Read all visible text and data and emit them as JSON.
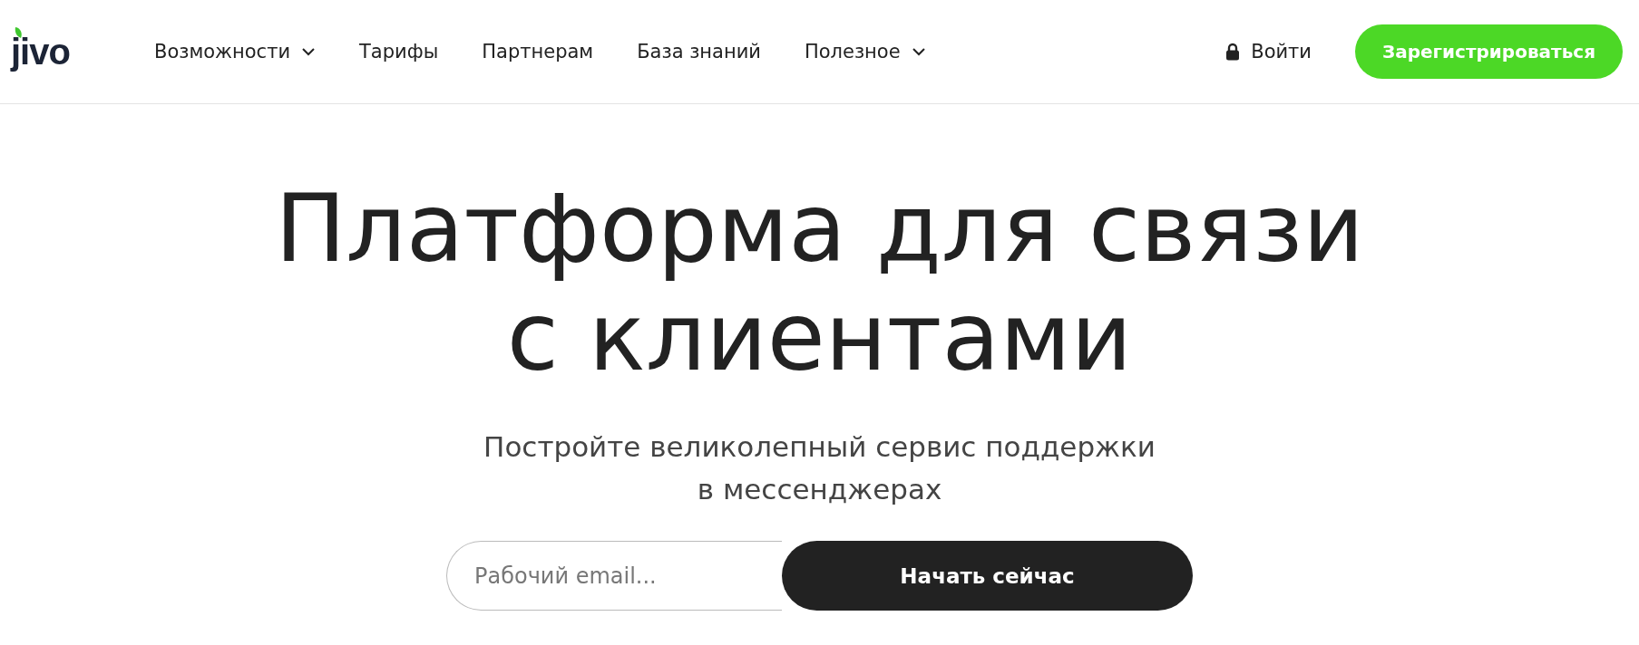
{
  "logo": {
    "text": "jivo"
  },
  "nav": [
    {
      "label": "Возможности",
      "dropdown": true
    },
    {
      "label": "Тарифы",
      "dropdown": false
    },
    {
      "label": "Партнерам",
      "dropdown": false
    },
    {
      "label": "База знаний",
      "dropdown": false
    },
    {
      "label": "Полезное",
      "dropdown": true
    }
  ],
  "login": {
    "label": "Войти"
  },
  "signup": {
    "label": "Зарегистрироваться"
  },
  "hero": {
    "title_lines": [
      "Платформа для связи",
      "с клиентами"
    ],
    "subtitle_lines": [
      "Постройте великолепный сервис поддержки",
      "в мессенджерах"
    ]
  },
  "form": {
    "placeholder": "Рабочий email...",
    "button": "Начать сейчас"
  }
}
